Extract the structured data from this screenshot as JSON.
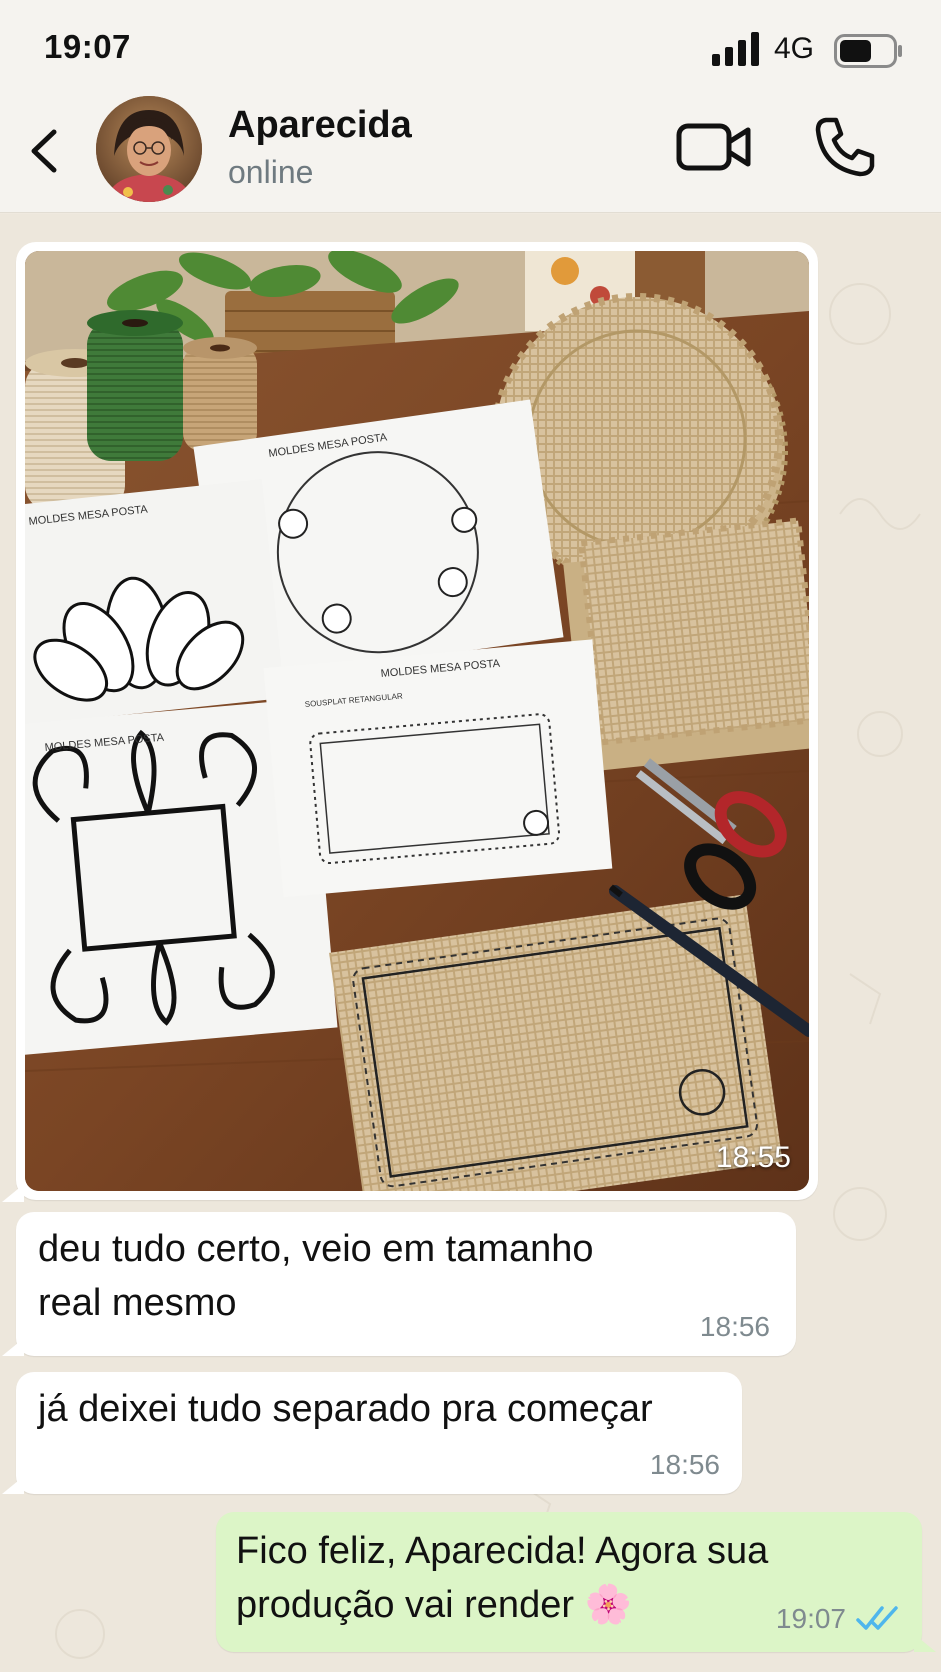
{
  "status_bar": {
    "time": "19:07",
    "network": "4G",
    "signal_icon": "signal-bars-icon",
    "battery_icon": "battery-icon",
    "battery_level": 0.6
  },
  "header": {
    "back_icon": "chevron-left-icon",
    "contact_name": "Aparecida",
    "contact_status": "online",
    "video_icon": "video-camera-icon",
    "phone_icon": "phone-icon"
  },
  "messages": [
    {
      "type": "image",
      "direction": "incoming",
      "time": "18:55"
    },
    {
      "type": "text",
      "direction": "incoming",
      "text": "deu tudo certo, veio em tamanho\nreal mesmo",
      "time": "18:56"
    },
    {
      "type": "text",
      "direction": "incoming",
      "text": "já deixei tudo separado pra começar",
      "time": "18:56"
    },
    {
      "type": "text",
      "direction": "outgoing",
      "text": "Fico feliz, Aparecida! Agora sua\nprodução vai render 🌸",
      "time": "19:07",
      "status_icon": "double-check-read-icon"
    }
  ],
  "photo_labels": {
    "sheet_1": "MOLDES MESA POSTA",
    "sheet_2": "MOLDES MESA POSTA",
    "sheet_3": "MOLDES MESA POSTA",
    "sheet_4": "MOLDES MESA POSTA",
    "sheet_4_sub": "SOUSPLAT RETANGULAR"
  },
  "colors": {
    "outgoing_bubble": "#dcf5c7",
    "incoming_bubble": "#ffffff",
    "chat_background": "#ede7dc",
    "read_ticks": "#4fb6ec"
  }
}
